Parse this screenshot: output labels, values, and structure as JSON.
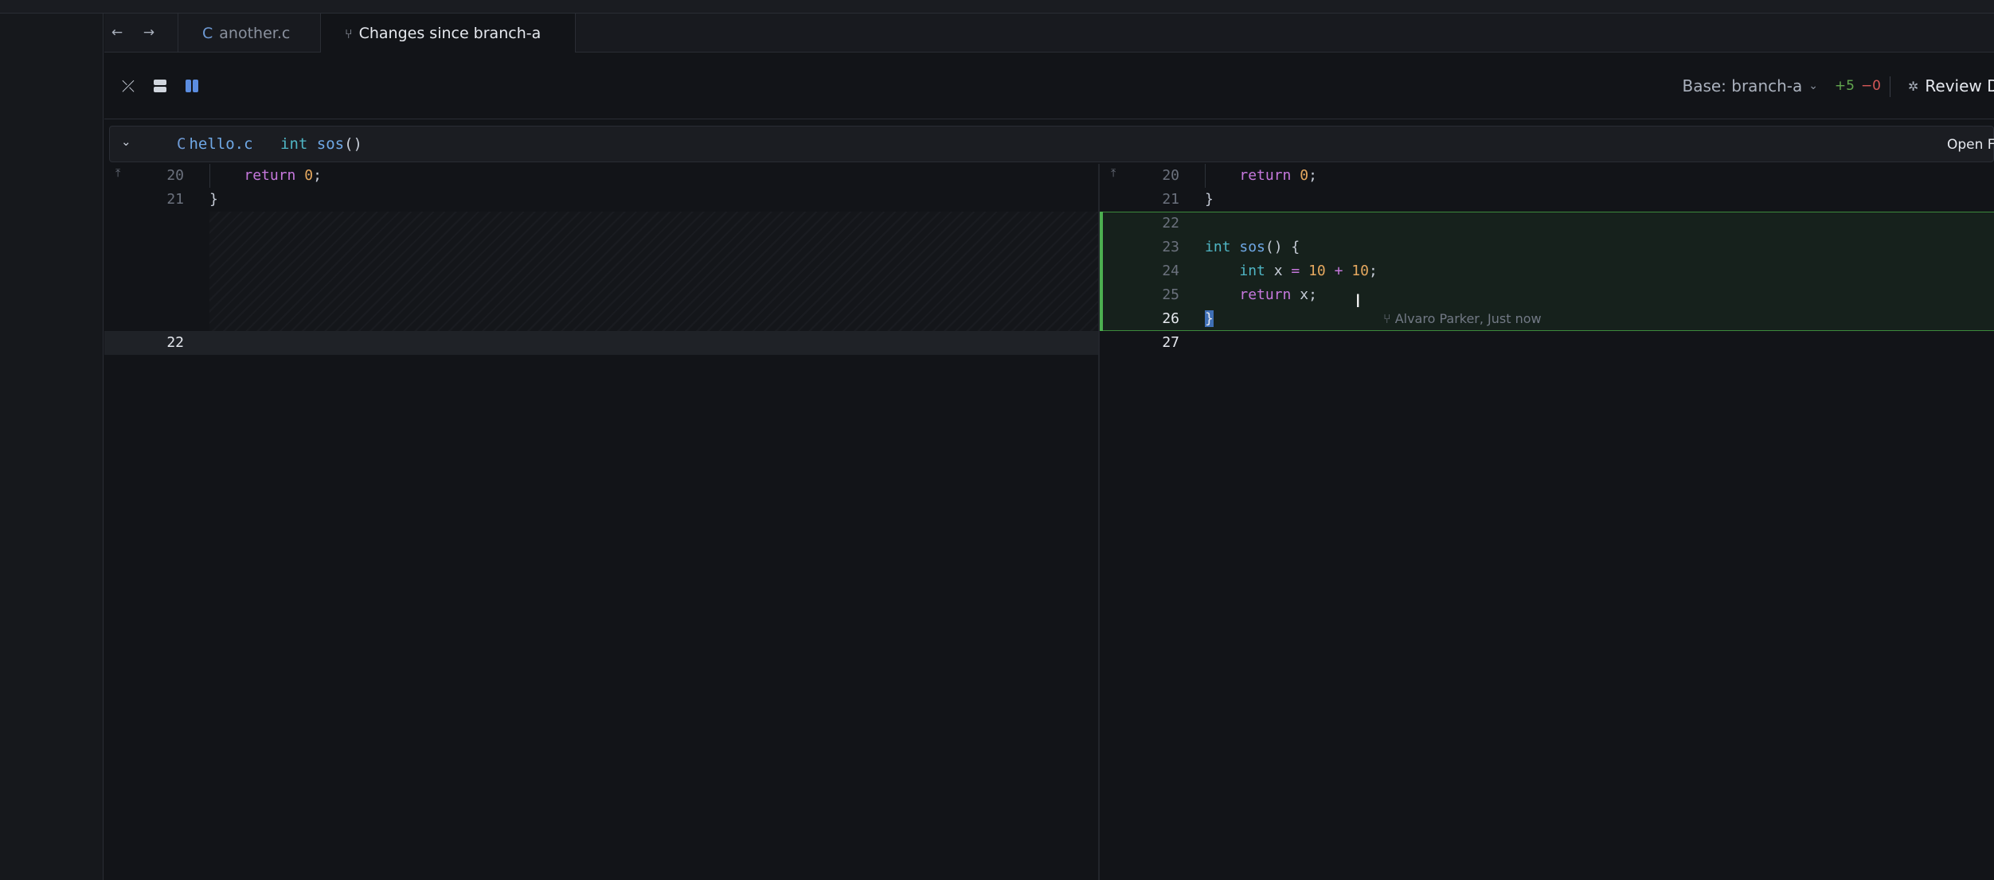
{
  "tabs": [
    {
      "label": "another.c",
      "icon": "c-file-icon"
    },
    {
      "label": "Changes since branch-a",
      "icon": "git-branch-icon"
    }
  ],
  "toolbar": {
    "base_label": "Base: branch-a",
    "additions": "+5",
    "deletions": "−0",
    "review_label": "Review D"
  },
  "file_header": {
    "filename": "hello.c",
    "crumb_type": "int",
    "crumb_fn": "sos",
    "crumb_parens": "()",
    "open_label": "Open Fi"
  },
  "left_pane": {
    "lines": [
      {
        "num": "20",
        "tokens": [
          {
            "t": "    ",
            "c": "plain"
          },
          {
            "t": "return",
            "c": "kw"
          },
          {
            "t": " ",
            "c": "plain"
          },
          {
            "t": "0",
            "c": "num"
          },
          {
            "t": ";",
            "c": "plain"
          }
        ]
      },
      {
        "num": "21",
        "tokens": [
          {
            "t": "}",
            "c": "plain"
          }
        ]
      },
      {
        "num": "22",
        "tokens": []
      }
    ]
  },
  "right_pane": {
    "lines": [
      {
        "num": "20",
        "tokens": [
          {
            "t": "    ",
            "c": "plain"
          },
          {
            "t": "return",
            "c": "kw"
          },
          {
            "t": " ",
            "c": "plain"
          },
          {
            "t": "0",
            "c": "num"
          },
          {
            "t": ";",
            "c": "plain"
          }
        ]
      },
      {
        "num": "21",
        "tokens": [
          {
            "t": "}",
            "c": "plain"
          }
        ]
      },
      {
        "num": "22",
        "tokens": []
      },
      {
        "num": "23",
        "tokens": [
          {
            "t": "int",
            "c": "kw-type"
          },
          {
            "t": " ",
            "c": "plain"
          },
          {
            "t": "sos",
            "c": "fn"
          },
          {
            "t": "() {",
            "c": "plain"
          }
        ]
      },
      {
        "num": "24",
        "tokens": [
          {
            "t": "    ",
            "c": "plain"
          },
          {
            "t": "int",
            "c": "kw-type"
          },
          {
            "t": " x ",
            "c": "plain"
          },
          {
            "t": "=",
            "c": "op"
          },
          {
            "t": " ",
            "c": "plain"
          },
          {
            "t": "10",
            "c": "num"
          },
          {
            "t": " ",
            "c": "plain"
          },
          {
            "t": "+",
            "c": "op"
          },
          {
            "t": " ",
            "c": "plain"
          },
          {
            "t": "10",
            "c": "num"
          },
          {
            "t": ";",
            "c": "plain"
          }
        ]
      },
      {
        "num": "25",
        "tokens": [
          {
            "t": "    ",
            "c": "plain"
          },
          {
            "t": "return",
            "c": "kw"
          },
          {
            "t": " x;",
            "c": "plain"
          }
        ]
      },
      {
        "num": "26",
        "tokens": [
          {
            "t": "}",
            "c": "cursor-sel"
          }
        ]
      },
      {
        "num": "27",
        "tokens": []
      }
    ],
    "blame": "Alvaro Parker, Just now"
  },
  "colors": {
    "added_border": "#4caf50",
    "keyword": "#c678dd",
    "type": "#4fb5c4",
    "function": "#6fa8e6",
    "number": "#e5a85f"
  }
}
